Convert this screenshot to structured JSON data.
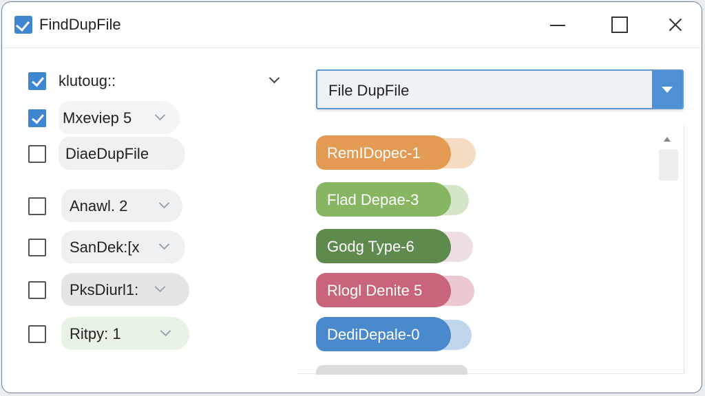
{
  "window": {
    "title": "FindDupFile"
  },
  "options": [
    {
      "label": "klutoug::",
      "checked": true,
      "pill_color": ""
    },
    {
      "label": "Mxeviep 5",
      "checked": true,
      "pill_color": "#f2f4f5"
    },
    {
      "label": "DiaeDupFile",
      "checked": false,
      "pill_color": "#eef0f1"
    },
    {
      "label": "Anawl. 2",
      "checked": false,
      "pill_color": "#eef0f1"
    },
    {
      "label": "SanDek:[x",
      "checked": false,
      "pill_color": "#eef0f1"
    },
    {
      "label": "PksDiurl1:",
      "checked": false,
      "pill_color": "#e3e5e7"
    },
    {
      "label": "Ritpy: 1",
      "checked": false,
      "pill_color": "#e8f3e6"
    }
  ],
  "dropdown": {
    "value": "File DupFile"
  },
  "tags": [
    {
      "label": "RemIDopec-1",
      "color": "#e39a52"
    },
    {
      "label": "Flad Depae-3",
      "color": "#86b661"
    },
    {
      "label": "Godg Type-6",
      "color": "#5f8a4d"
    },
    {
      "label": "Rlogl Denite 5",
      "color": "#c8657a"
    },
    {
      "label": "DediDepale-0",
      "color": "#4a89cc"
    }
  ]
}
